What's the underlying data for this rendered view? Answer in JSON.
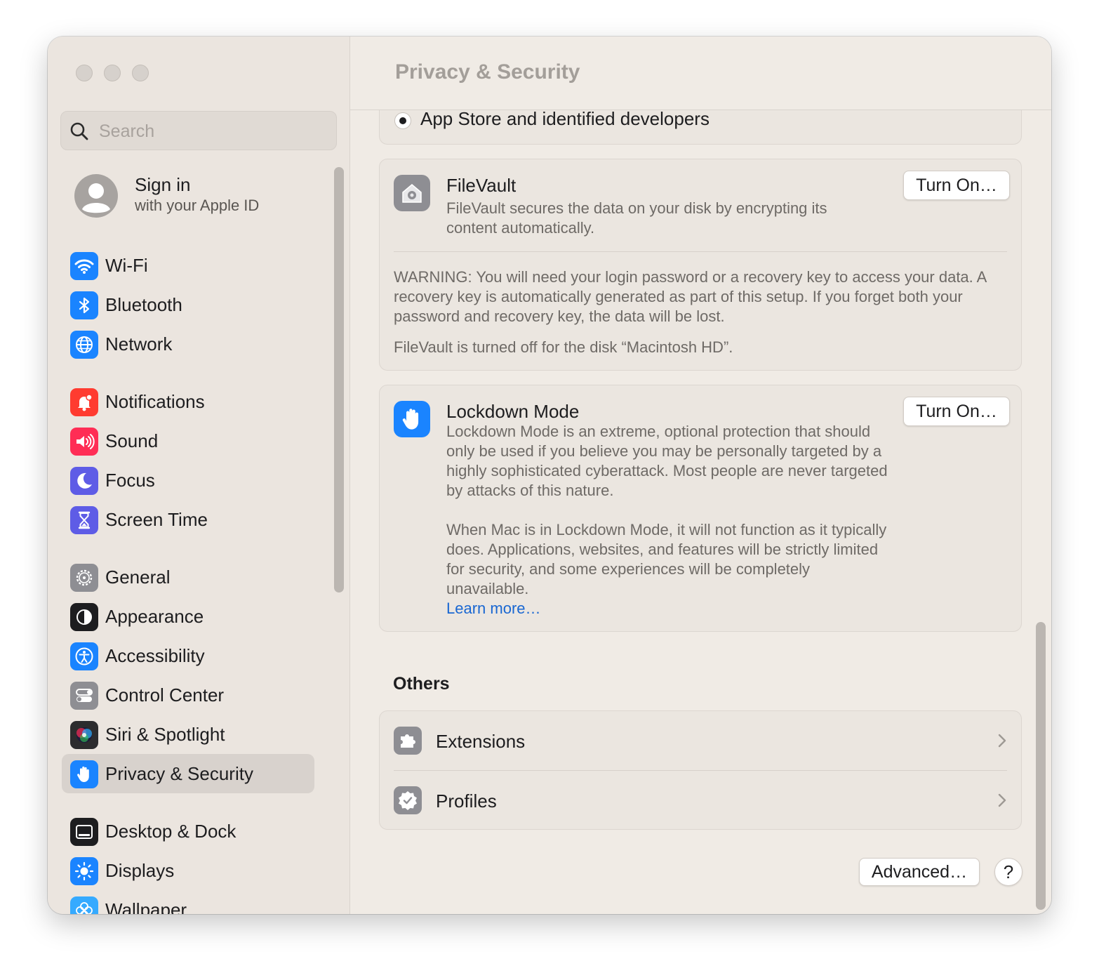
{
  "window": {
    "title": "Privacy & Security"
  },
  "search": {
    "placeholder": "Search"
  },
  "account": {
    "title": "Sign in",
    "subtitle": "with your Apple ID"
  },
  "sidebar": {
    "items": [
      {
        "label": "Wi-Fi",
        "icon": "wifi-icon",
        "color": "#1a84ff"
      },
      {
        "label": "Bluetooth",
        "icon": "bluetooth-icon",
        "color": "#1a84ff"
      },
      {
        "label": "Network",
        "icon": "globe-icon",
        "color": "#1a84ff"
      },
      {
        "label": "Notifications",
        "icon": "bell-icon",
        "color": "#ff3b30"
      },
      {
        "label": "Sound",
        "icon": "speaker-icon",
        "color": "#ff2d55"
      },
      {
        "label": "Focus",
        "icon": "moon-icon",
        "color": "#5e5ce6"
      },
      {
        "label": "Screen Time",
        "icon": "hourglass-icon",
        "color": "#5e5ce6"
      },
      {
        "label": "General",
        "icon": "gear-icon",
        "color": "#8e8e93"
      },
      {
        "label": "Appearance",
        "icon": "appearance-icon",
        "color": "#1d1d1f"
      },
      {
        "label": "Accessibility",
        "icon": "accessibility-icon",
        "color": "#1a84ff"
      },
      {
        "label": "Control Center",
        "icon": "toggles-icon",
        "color": "#8e8e93"
      },
      {
        "label": "Siri & Spotlight",
        "icon": "siri-icon",
        "color": "#2c2c2e"
      },
      {
        "label": "Privacy & Security",
        "icon": "hand-icon",
        "color": "#1a84ff",
        "selected": true
      },
      {
        "label": "Desktop & Dock",
        "icon": "dock-icon",
        "color": "#1d1d1f"
      },
      {
        "label": "Displays",
        "icon": "sun-icon",
        "color": "#1a84ff"
      },
      {
        "label": "Wallpaper",
        "icon": "flower-icon",
        "color": "#35aaff"
      }
    ]
  },
  "security": {
    "allow_option": "App Store and identified developers"
  },
  "filevault": {
    "title": "FileVault",
    "description": "FileVault secures the data on your disk by encrypting its content automatically.",
    "button": "Turn On…",
    "warning": "WARNING: You will need your login password or a recovery key to access your data. A recovery key is automatically generated as part of this setup. If you forget both your password and recovery key, the data will be lost.",
    "status": "FileVault is turned off for the disk “Macintosh HD”."
  },
  "lockdown": {
    "title": "Lockdown Mode",
    "button": "Turn On…",
    "description_1": "Lockdown Mode is an extreme, optional protection that should only be used if you believe you may be personally targeted by a highly sophisticated cyberattack. Most people are never targeted by attacks of this nature.",
    "description_2": "When Mac is in Lockdown Mode, it will not function as it typically does. Applications, websites, and features will be strictly limited for security, and some experiences will be completely unavailable.",
    "learn_more": "Learn more…"
  },
  "others": {
    "title": "Others",
    "items": [
      {
        "label": "Extensions",
        "icon": "puzzle-icon"
      },
      {
        "label": "Profiles",
        "icon": "badge-check-icon"
      }
    ]
  },
  "footer": {
    "advanced_button": "Advanced…",
    "help_button": "?"
  }
}
